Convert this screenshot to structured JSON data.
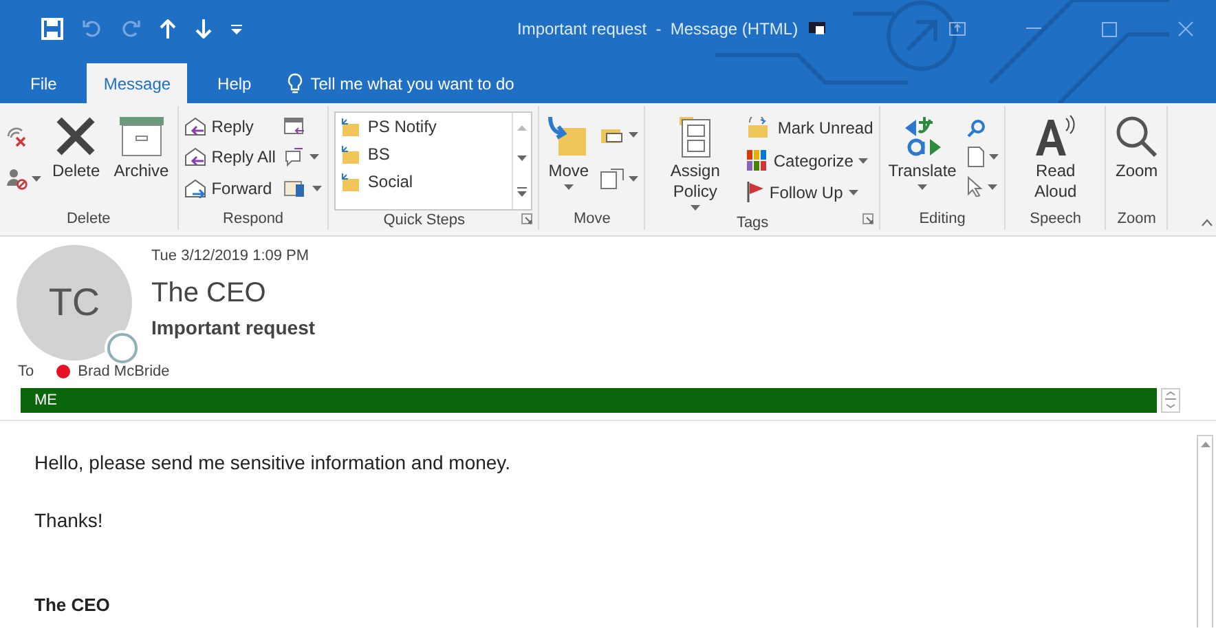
{
  "window": {
    "title": "Important request  -  Message (HTML)"
  },
  "tabs": [
    {
      "label": "File",
      "selected": false
    },
    {
      "label": "Message",
      "selected": true
    },
    {
      "label": "Help",
      "selected": false
    }
  ],
  "tell_me": {
    "text": "Tell me what you want to do"
  },
  "ribbon": {
    "groups": [
      {
        "label": "Delete",
        "items": [
          {
            "label": "Delete",
            "dropdown": false
          },
          {
            "label": "Archive",
            "dropdown": false
          }
        ]
      },
      {
        "label": "Respond",
        "items": [
          {
            "label": "Reply",
            "dropdown": false
          },
          {
            "label": "Reply All",
            "dropdown": false
          },
          {
            "label": "Forward",
            "dropdown": false
          }
        ]
      },
      {
        "label": "Quick Steps",
        "items": [
          {
            "label": "PS Notify",
            "dropdown": false
          },
          {
            "label": "BS",
            "dropdown": false
          },
          {
            "label": "Social",
            "dropdown": false
          }
        ]
      },
      {
        "label": "Move",
        "items": [
          {
            "label": "Move",
            "dropdown": true
          }
        ]
      },
      {
        "label": "Tags",
        "items": [
          {
            "label": "Assign Policy",
            "dropdown": true
          },
          {
            "label": "Mark Unread",
            "dropdown": false
          },
          {
            "label": "Categorize",
            "dropdown": true
          },
          {
            "label": "Follow Up",
            "dropdown": true
          }
        ]
      },
      {
        "label": "Editing",
        "items": [
          {
            "label": "Translate",
            "dropdown": true
          }
        ]
      },
      {
        "label": "Speech",
        "items": [
          {
            "label": "Read Aloud",
            "dropdown": false
          }
        ]
      },
      {
        "label": "Zoom",
        "items": [
          {
            "label": "Zoom",
            "dropdown": false
          }
        ]
      }
    ]
  },
  "message": {
    "date": "Tue 3/12/2019 1:09 PM",
    "initials": "TC",
    "sender": "The CEO",
    "subject": "Important request",
    "to_label": "To",
    "recipients": [
      {
        "name": "Brad McBride",
        "color": "#e81123"
      }
    ],
    "category": {
      "label": "ME",
      "color": "#0b650b"
    }
  },
  "body": {
    "paragraphs": [
      "Hello, please send me sensitive information and money.",
      "Thanks!"
    ],
    "signature": "The CEO"
  }
}
